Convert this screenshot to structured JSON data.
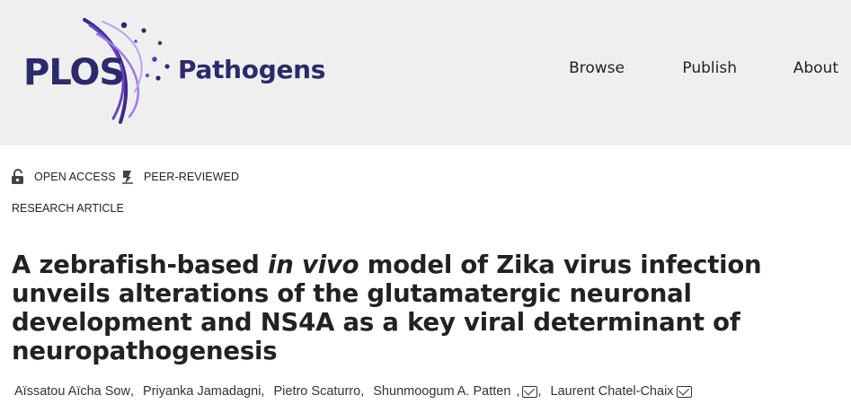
{
  "header": {
    "logo_plos": "PLOS",
    "logo_journal": "Pathogens",
    "nav": [
      {
        "label": "Browse"
      },
      {
        "label": "Publish"
      },
      {
        "label": "About"
      }
    ]
  },
  "badges": [
    {
      "label": "OPEN ACCESS",
      "icon": "open-lock-icon"
    },
    {
      "label": "PEER-REVIEWED",
      "icon": "peer-review-icon"
    }
  ],
  "article_type": "RESEARCH ARTICLE",
  "title": {
    "part1": "A zebrafish-based ",
    "italic": "in vivo",
    "part2": " model of Zika virus infection unveils alterations of the glutamatergic neuronal development and NS4A as a key viral determinant of neuropathogenesis"
  },
  "authors": [
    {
      "name": "Aïssatou Aïcha Sow",
      "sep": ","
    },
    {
      "name": "Priyanka Jamadagni",
      "sep": ","
    },
    {
      "name": "Pietro Scaturro",
      "sep": ","
    },
    {
      "name": "Shunmoogum A. Patten",
      "sep": ""
    },
    {
      "name": "Laurent Chatel-Chaix",
      "sep": ""
    }
  ],
  "colors": {
    "brand": "#2c2a6b",
    "accent_purple": "#7b4fc9",
    "header_bg": "#efefef"
  }
}
